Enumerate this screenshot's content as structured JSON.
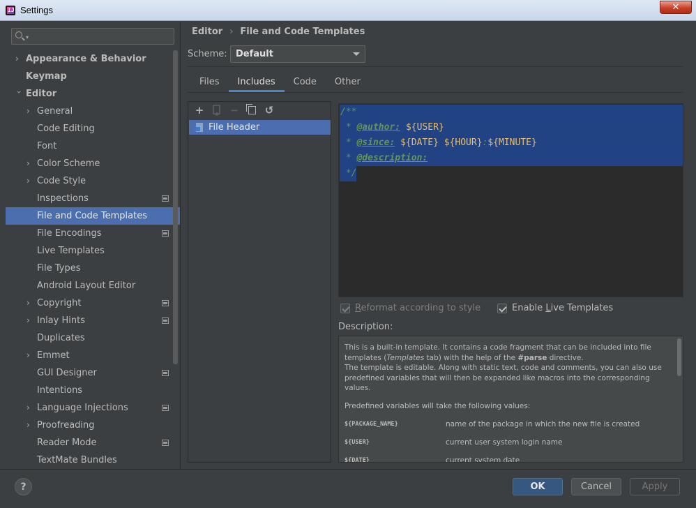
{
  "window": {
    "title": "Settings",
    "app_icon_glyph": "IJ",
    "close_glyph": "✕"
  },
  "search": {
    "placeholder": "",
    "value": ""
  },
  "sidebar": {
    "items": [
      {
        "label": "Appearance & Behavior",
        "arrow": "›",
        "bold": true,
        "level": 0,
        "expanded": false
      },
      {
        "label": "Keymap",
        "arrow": "",
        "bold": true,
        "level": 0
      },
      {
        "label": "Editor",
        "arrow": "›",
        "bold": true,
        "level": 0,
        "expanded": true
      },
      {
        "label": "General",
        "arrow": "›",
        "level": 1
      },
      {
        "label": "Code Editing",
        "arrow": "",
        "level": 1
      },
      {
        "label": "Font",
        "arrow": "",
        "level": 1
      },
      {
        "label": "Color Scheme",
        "arrow": "›",
        "level": 1
      },
      {
        "label": "Code Style",
        "arrow": "›",
        "level": 1
      },
      {
        "label": "Inspections",
        "arrow": "",
        "level": 1,
        "project_icon": true
      },
      {
        "label": "File and Code Templates",
        "arrow": "",
        "level": 1,
        "selected": true
      },
      {
        "label": "File Encodings",
        "arrow": "",
        "level": 1,
        "project_icon": true
      },
      {
        "label": "Live Templates",
        "arrow": "",
        "level": 1
      },
      {
        "label": "File Types",
        "arrow": "",
        "level": 1
      },
      {
        "label": "Android Layout Editor",
        "arrow": "",
        "level": 1
      },
      {
        "label": "Copyright",
        "arrow": "›",
        "level": 1,
        "project_icon": true
      },
      {
        "label": "Inlay Hints",
        "arrow": "›",
        "level": 1,
        "project_icon": true
      },
      {
        "label": "Duplicates",
        "arrow": "",
        "level": 1
      },
      {
        "label": "Emmet",
        "arrow": "›",
        "level": 1
      },
      {
        "label": "GUI Designer",
        "arrow": "",
        "level": 1,
        "project_icon": true
      },
      {
        "label": "Intentions",
        "arrow": "",
        "level": 1
      },
      {
        "label": "Language Injections",
        "arrow": "›",
        "level": 1,
        "project_icon": true
      },
      {
        "label": "Proofreading",
        "arrow": "›",
        "level": 1
      },
      {
        "label": "Reader Mode",
        "arrow": "",
        "level": 1,
        "project_icon": true
      },
      {
        "label": "TextMate Bundles",
        "arrow": "",
        "level": 1
      }
    ]
  },
  "breadcrumb": {
    "parent": "Editor",
    "separator": "›",
    "current": "File and Code Templates"
  },
  "scheme": {
    "label": "Scheme:",
    "value": "Default"
  },
  "tabs": [
    {
      "label": "Files",
      "active": false
    },
    {
      "label": "Includes",
      "active": true
    },
    {
      "label": "Code",
      "active": false
    },
    {
      "label": "Other",
      "active": false
    }
  ],
  "template_list": {
    "toolbar": {
      "add_glyph": "+",
      "remove_glyph": "−",
      "reset_glyph": "↺"
    },
    "items": [
      {
        "label": "File Header",
        "selected": true
      }
    ]
  },
  "editor": {
    "line1": "/**",
    "line2_prefix": " * ",
    "line2_tag": "@author:",
    "line2_var": "${USER}",
    "line3_prefix": " * ",
    "line3_tag": "@since:",
    "line3_var1": "${DATE}",
    "line3_var2": "${HOUR}",
    "line3_colon": ":",
    "line3_var3": "${MINUTE}",
    "line4_prefix": " * ",
    "line4_tag": "@description:",
    "line5": " */"
  },
  "options": {
    "reformat": {
      "label_underlined": "R",
      "label_rest": "eformat according to style",
      "checked": true,
      "enabled": false
    },
    "live_templates": {
      "label_pre": "Enable ",
      "label_underlined": "L",
      "label_rest": "ive Templates",
      "checked": true,
      "enabled": true
    }
  },
  "description": {
    "label": "Description:",
    "para1_a": "This is a built-in template. It contains a code fragment that can be included into file templates (",
    "para1_em": "Templates",
    "para1_b": " tab) with the help of the ",
    "para1_bold": "#parse",
    "para1_c": " directive.",
    "para1_d": "The template is editable. Along with static text, code and comments, you can also use predefined variables that will then be expanded like macros into the corresponding values.",
    "para2": "Predefined variables will take the following values:",
    "variables": [
      {
        "name": "${PACKAGE_NAME}",
        "desc": "name of the package in which the new file is created"
      },
      {
        "name": "${USER}",
        "desc": "current user system login name"
      },
      {
        "name": "${DATE}",
        "desc": "current system date"
      }
    ]
  },
  "buttons": {
    "help": "?",
    "ok": "OK",
    "cancel": "Cancel",
    "apply": "Apply"
  },
  "colors": {
    "background": "#3c3f41",
    "selection": "#4b6eaf",
    "editor_bg": "#2b2b2b",
    "editor_selection": "#214283",
    "doc_comment": "#629755",
    "template_var": "#e8bf6a",
    "ok_button": "#365880"
  }
}
